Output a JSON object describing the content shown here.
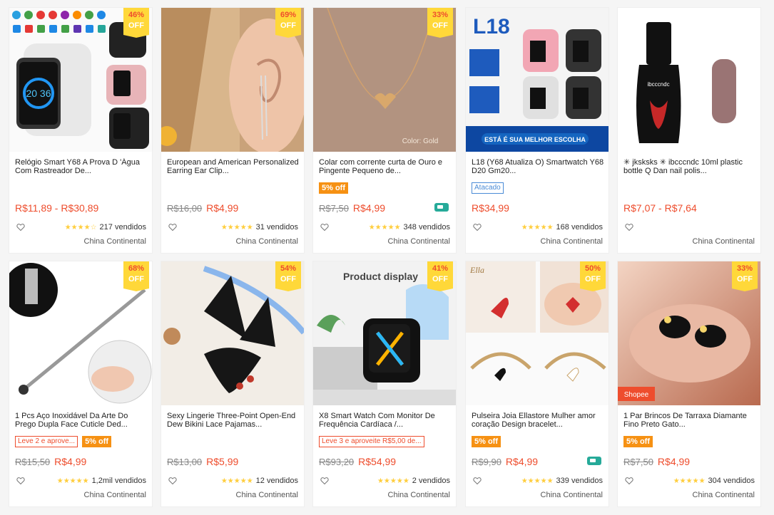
{
  "products": [
    {
      "title": "Relógio Smart Y68 A Prova D 'Água Com Rastreador De...",
      "discount": "46%",
      "off": "OFF",
      "price": "R$11,89 - R$30,89",
      "old_price": "",
      "badge": "",
      "badge_type": "",
      "sold": "217 vendidos",
      "stars": "★★★★☆",
      "location": "China Continental",
      "free_ship": false,
      "img": "watch1"
    },
    {
      "title": "European and American Personalized Earring Ear Clip...",
      "discount": "69%",
      "off": "OFF",
      "price": "R$4,99",
      "old_price": "R$16,00",
      "badge": "",
      "badge_type": "",
      "sold": "31 vendidos",
      "stars": "★★★★★",
      "location": "China Continental",
      "free_ship": false,
      "img": "ear"
    },
    {
      "title": "Colar com corrente curta de Ouro e Pingente Pequeno de...",
      "discount": "33%",
      "off": "OFF",
      "price": "R$4,99",
      "old_price": "R$7,50",
      "badge": "5% off",
      "badge_type": "discount",
      "sold": "348 vendidos",
      "stars": "★★★★★",
      "location": "China Continental",
      "free_ship": true,
      "img": "necklace"
    },
    {
      "title": "L18 (Y68 Atualiza O) Smartwatch Y68 D20 Gm20...",
      "discount": "",
      "off": "",
      "price": "R$34,99",
      "old_price": "",
      "badge": "Atacado",
      "badge_type": "outline",
      "sold": "168 vendidos",
      "stars": "★★★★★",
      "location": "China Continental",
      "free_ship": false,
      "img": "watch2"
    },
    {
      "title": "✳ jksksks ✳ ibcccndc 10ml plastic bottle Q Dan nail polis...",
      "discount": "",
      "off": "",
      "price": "R$7,07 - R$7,64",
      "old_price": "",
      "badge": "",
      "badge_type": "",
      "sold": "",
      "stars": "",
      "location": "China Continental",
      "free_ship": false,
      "img": "polish"
    },
    {
      "title": "1 Pcs Aço Inoxidável Da Arte Do Prego Dupla Face Cuticle Ded...",
      "discount": "68%",
      "off": "OFF",
      "price": "R$4,99",
      "old_price": "R$15,50",
      "badge": "Leve 2 e aprove...",
      "badge_type": "promo",
      "badge2": "5% off",
      "sold": "1,2mil vendidos",
      "stars": "★★★★★",
      "location": "China Continental",
      "free_ship": false,
      "img": "tool"
    },
    {
      "title": "Sexy Lingerie Three-Point Open-End Dew Bikini Lace Pajamas...",
      "discount": "54%",
      "off": "OFF",
      "price": "R$5,99",
      "old_price": "R$13,00",
      "badge": "",
      "badge_type": "",
      "sold": "12 vendidos",
      "stars": "★★★★★",
      "location": "China Continental",
      "free_ship": false,
      "img": "lingerie"
    },
    {
      "title": "X8 Smart Watch Com Monitor De Frequência Cardíaca /...",
      "discount": "41%",
      "off": "OFF",
      "price": "R$54,99",
      "old_price": "R$93,20",
      "badge": "Leve 3 e aproveite R$5,00 de...",
      "badge_type": "promo",
      "sold": "2 vendidos",
      "stars": "★★★★★",
      "location": "China Continental",
      "free_ship": false,
      "img": "watch3",
      "img_text": "Product display"
    },
    {
      "title": "Pulseira Joia Ellastore Mulher amor coração Design bracelet...",
      "discount": "50%",
      "off": "OFF",
      "price": "R$4,99",
      "old_price": "R$9,90",
      "badge": "5% off",
      "badge_type": "discount",
      "sold": "339 vendidos",
      "stars": "★★★★★",
      "location": "China Continental",
      "free_ship": true,
      "img": "bracelet"
    },
    {
      "title": "1 Par Brincos De Tarraxa Diamante Fino Preto Gato...",
      "discount": "33%",
      "off": "OFF",
      "price": "R$4,99",
      "old_price": "R$7,50",
      "badge": "5% off",
      "badge_type": "discount",
      "sold": "304 vendidos",
      "stars": "★★★★★",
      "location": "China Continental",
      "free_ship": false,
      "img": "earrings"
    }
  ],
  "image_text": {
    "necklace_caption": "Color: Gold",
    "watch2_banner": "ESTÁ É SUA MELHOR ESCOLHA",
    "watch2_logo": "L18",
    "polish_label": "ibcccndc",
    "watch1_screen": "20 36",
    "shopee_tag": "Shopee",
    "bracelet_logo": "Ella"
  },
  "colors": {
    "accent": "#ee4d2d",
    "discount_bg": "#ffd839",
    "badge_orange": "#f69113",
    "star": "#ffce3d",
    "free_ship": "#26aa99"
  }
}
